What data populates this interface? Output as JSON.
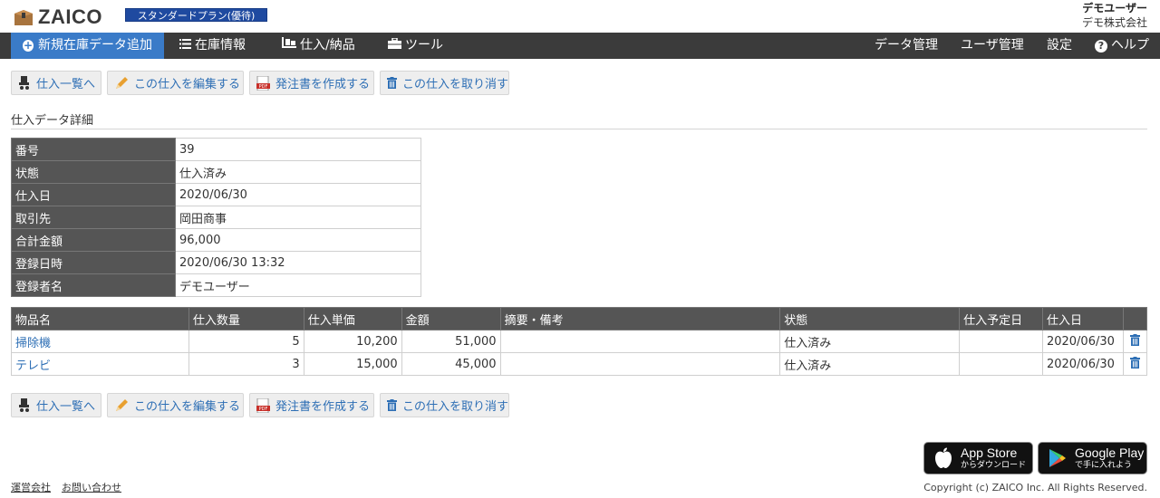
{
  "header": {
    "logo_text": "ZAICO",
    "plan": "スタンダードプラン(優待)",
    "user_name": "デモユーザー",
    "company": "デモ株式会社"
  },
  "nav": {
    "new_item": "新規在庫データ追加",
    "inventory": "在庫情報",
    "purchase": "仕入/納品",
    "tools": "ツール",
    "data_mgmt": "データ管理",
    "user_mgmt": "ユーザ管理",
    "settings": "設定",
    "help": "ヘルプ"
  },
  "actions": {
    "list": "仕入一覧へ",
    "edit": "この仕入を編集する",
    "order": "発注書を作成する",
    "cancel": "この仕入を取り消す"
  },
  "section_title": "仕入データ詳細",
  "detail": {
    "rows": [
      {
        "label": "番号",
        "value": "39"
      },
      {
        "label": "状態",
        "value": "仕入済み"
      },
      {
        "label": "仕入日",
        "value": "2020/06/30"
      },
      {
        "label": "取引先",
        "value": "岡田商事"
      },
      {
        "label": "合計金額",
        "value": "96,000"
      },
      {
        "label": "登録日時",
        "value": "2020/06/30 13:32"
      },
      {
        "label": "登録者名",
        "value": "デモユーザー"
      }
    ]
  },
  "items": {
    "columns": [
      "物品名",
      "仕入数量",
      "仕入単価",
      "金額",
      "摘要・備考",
      "状態",
      "仕入予定日",
      "仕入日"
    ],
    "rows": [
      {
        "name": "掃除機",
        "qty": "5",
        "unit": "10,200",
        "amount": "51,000",
        "note": "",
        "status": "仕入済み",
        "planned": "",
        "date": "2020/06/30"
      },
      {
        "name": "テレビ",
        "qty": "3",
        "unit": "15,000",
        "amount": "45,000",
        "note": "",
        "status": "仕入済み",
        "planned": "",
        "date": "2020/06/30"
      }
    ]
  },
  "footer": {
    "company_link": "運営会社",
    "contact_link": "お問い合わせ",
    "appstore_big": "App Store",
    "appstore_small": "からダウンロード",
    "googleplay_big": "Google Play",
    "googleplay_small": "で手に入れよう",
    "copyright": "Copyright (c) ZAICO Inc. All Rights Reserved."
  },
  "colors": {
    "accent": "#3a7bc8",
    "nav_bg": "#3b3b3b",
    "link": "#2e6fb5",
    "plan_badge": "#1f4aa0",
    "table_header": "#555555"
  }
}
